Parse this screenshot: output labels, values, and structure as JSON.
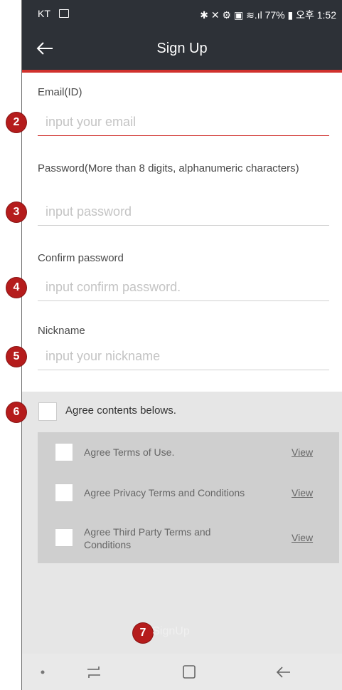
{
  "status_bar": {
    "carrier": "KT",
    "right_text": "✱ ✕ ⚙ ▣ ≋.ıl 77% ▮ 오후 1:52"
  },
  "app_bar": {
    "title": "Sign Up"
  },
  "form": {
    "email": {
      "label": "Email(ID)",
      "placeholder": "input your email",
      "value": ""
    },
    "password": {
      "label": "Password(More than 8 digits, alphanumeric characters)",
      "placeholder": "input password",
      "value": ""
    },
    "confirm": {
      "label": "Confirm password",
      "placeholder": "input confirm password.",
      "value": ""
    },
    "nickname": {
      "label": "Nickname",
      "placeholder": "input your nickname",
      "value": ""
    }
  },
  "agree": {
    "all_label": "Agree contents belows.",
    "terms": [
      {
        "label": "Agree Terms of Use.",
        "view": "View"
      },
      {
        "label": "Agree Privacy Terms and Conditions",
        "view": "View"
      },
      {
        "label": "Agree Third Party Terms and Conditions",
        "view": "View"
      }
    ]
  },
  "signup_label": "SignUp",
  "badges": [
    "2",
    "3",
    "4",
    "5",
    "6",
    "7"
  ],
  "colors": {
    "appbar": "#2d3137",
    "accent": "#d0312d",
    "badge": "#b51c1c",
    "section_bg": "#e6e6e6"
  }
}
